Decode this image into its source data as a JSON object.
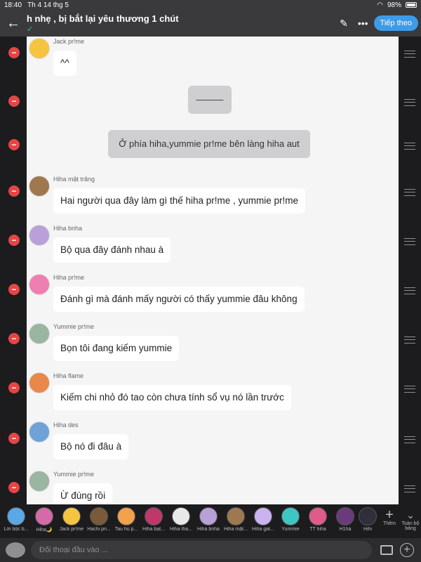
{
  "status": {
    "time": "18:40",
    "date": "Th 4 14 thg 5",
    "battery": "98%"
  },
  "header": {
    "title": "h nhẹ , bị bắt lại yêu thương 1 chút",
    "next_label": "Tiếp theo",
    "check": "✓"
  },
  "colors": {
    "accent": "#3d9be9",
    "delete": "#e64545"
  },
  "messages": [
    {
      "sender": "Jack pr!me",
      "text": "^^"
    },
    {
      "system": "———"
    },
    {
      "system": "Ở phía  hiha,yummie pr!me bên làng hiha aut"
    },
    {
      "sender": "Hiha mặt trăng",
      "text": "Hai người qua đây làm gì thế hiha pr!me , yummie pr!me"
    },
    {
      "sender": "Hiha bnha",
      "text": "Bộ qua đây đánh nhau à"
    },
    {
      "sender": "Hiha pr!me",
      "text": "Đánh gì mà đánh mấy người có thấy yummie đâu không"
    },
    {
      "sender": "Yummie pr!me",
      "text": "Bọn tôi đang kiếm yummie"
    },
    {
      "sender": "Hiha flame",
      "text": "Kiếm chi nhỏ đó tao còn chưa tính sổ vụ nó lần trước"
    },
    {
      "sender": "Hiha des",
      "text": "Bộ nó đi đâu à"
    },
    {
      "sender": "Yummie pr!me",
      "text": "Ừ đúng rồi"
    }
  ],
  "characters": [
    "Lời bộc b...",
    "Hiha🌙",
    "Jack pr!me",
    "Hachi pri...",
    "Tau hủ p...",
    "Hiha bạt...",
    "Hiha tha...",
    "Hiha bnha",
    "Hiha mặt...",
    "Hiha gat...",
    "Yummie",
    "TT hiha",
    "H1hả",
    "Hihi"
  ],
  "strip": {
    "add_label": "Thêm",
    "all_label": "Toàn bộ bảng"
  },
  "input": {
    "placeholder": "Đối thoại đầu vào ..."
  }
}
